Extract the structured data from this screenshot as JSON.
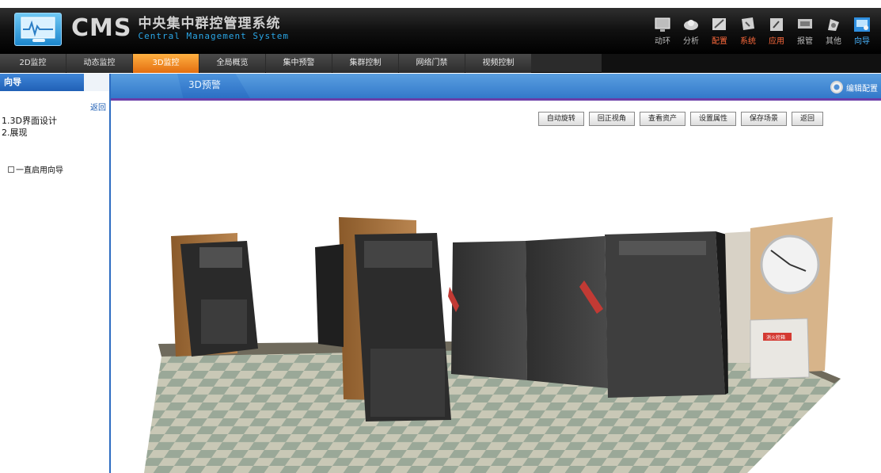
{
  "app": {
    "brand": "CMS",
    "title_zh": "中央集中群控管理系统",
    "title_en": "Central Management System"
  },
  "toolbar": {
    "items": [
      {
        "label": "动环",
        "icon": "monitor-icon",
        "state": "normal"
      },
      {
        "label": "分析",
        "icon": "analysis-icon",
        "state": "normal"
      },
      {
        "label": "配置",
        "icon": "config-icon",
        "state": "hot"
      },
      {
        "label": "系统",
        "icon": "system-icon",
        "state": "hot"
      },
      {
        "label": "应用",
        "icon": "apps-icon",
        "state": "hot"
      },
      {
        "label": "报管",
        "icon": "report-icon",
        "state": "normal"
      },
      {
        "label": "其他",
        "icon": "other-icon",
        "state": "normal"
      },
      {
        "label": "向导",
        "icon": "wizard-icon",
        "state": "active"
      }
    ]
  },
  "nav": {
    "tabs": [
      "2D监控",
      "动态监控",
      "3D监控",
      "全局概览",
      "集中预警",
      "集群控制",
      "网络门禁",
      "视频控制"
    ],
    "active": "3D监控"
  },
  "sidebar": {
    "title": "向导",
    "back": "返回",
    "items": [
      "1.3D界面设计",
      "2.展现"
    ],
    "checkbox_label": "一直启用向导"
  },
  "subheader": {
    "tab": "3D预警",
    "edit_label": "编辑配置"
  },
  "scene": {
    "buttons": [
      "自动旋转",
      "回正视角",
      "查看资产",
      "设置属性",
      "保存场景",
      "返回"
    ],
    "panel_label": "消火栓箱"
  },
  "colors": {
    "accent_orange": "#ff7b1c",
    "nav_blue": "#2f75c8",
    "sub_purple": "#6a3ea8"
  }
}
